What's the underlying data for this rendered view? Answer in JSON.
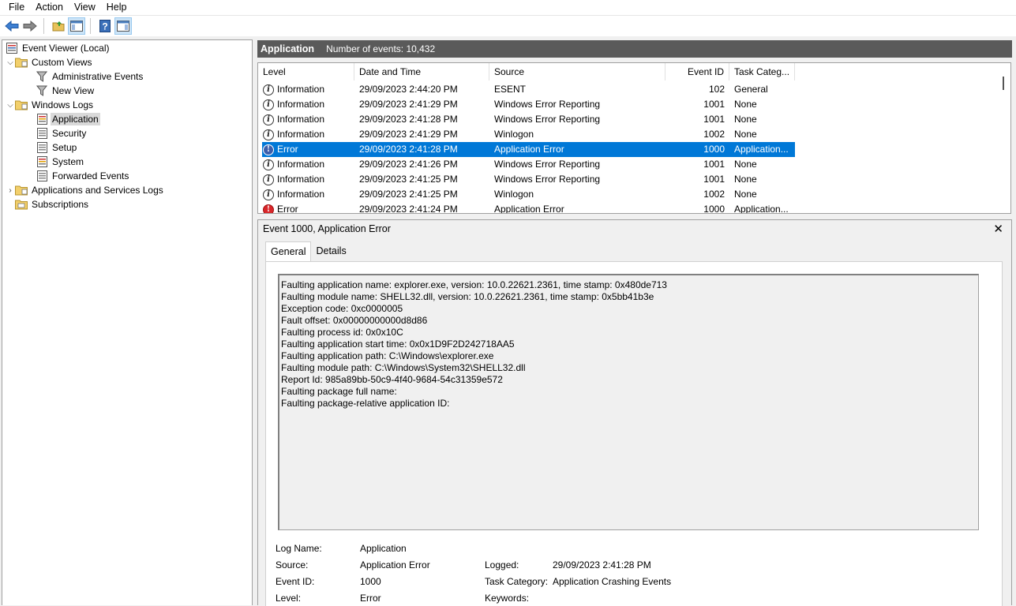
{
  "menu": [
    "File",
    "Action",
    "View",
    "Help"
  ],
  "toolbar": {
    "icons": [
      "back-arrow-icon",
      "forward-arrow-icon",
      "open-folder-icon",
      "show-hide-tree-icon",
      "help-icon",
      "action-pane-icon"
    ]
  },
  "tree": {
    "root": "Event Viewer (Local)",
    "custom_views": "Custom Views",
    "administrative_events": "Administrative Events",
    "new_view": "New View",
    "windows_logs": "Windows Logs",
    "application": "Application",
    "security": "Security",
    "setup": "Setup",
    "system": "System",
    "forwarded_events": "Forwarded Events",
    "app_services_logs": "Applications and Services Logs",
    "subscriptions": "Subscriptions"
  },
  "list_header": {
    "log_name": "Application",
    "count_text": "Number of events: 10,432"
  },
  "columns": {
    "level": "Level",
    "date": "Date and Time",
    "source": "Source",
    "event_id": "Event ID",
    "task": "Task Categ..."
  },
  "events": [
    {
      "level": "Information",
      "type": "info",
      "date": "29/09/2023 2:44:20 PM",
      "source": "ESENT",
      "id": "102",
      "task": "General"
    },
    {
      "level": "Information",
      "type": "info",
      "date": "29/09/2023 2:41:29 PM",
      "source": "Windows Error Reporting",
      "id": "1001",
      "task": "None"
    },
    {
      "level": "Information",
      "type": "info",
      "date": "29/09/2023 2:41:28 PM",
      "source": "Windows Error Reporting",
      "id": "1001",
      "task": "None"
    },
    {
      "level": "Information",
      "type": "info",
      "date": "29/09/2023 2:41:29 PM",
      "source": "Winlogon",
      "id": "1002",
      "task": "None"
    },
    {
      "level": "Error",
      "type": "err",
      "date": "29/09/2023 2:41:28 PM",
      "source": "Application Error",
      "id": "1000",
      "task": "Application...",
      "selected": true
    },
    {
      "level": "Information",
      "type": "info",
      "date": "29/09/2023 2:41:26 PM",
      "source": "Windows Error Reporting",
      "id": "1001",
      "task": "None"
    },
    {
      "level": "Information",
      "type": "info",
      "date": "29/09/2023 2:41:25 PM",
      "source": "Windows Error Reporting",
      "id": "1001",
      "task": "None"
    },
    {
      "level": "Information",
      "type": "info",
      "date": "29/09/2023 2:41:25 PM",
      "source": "Winlogon",
      "id": "1002",
      "task": "None"
    },
    {
      "level": "Error",
      "type": "err",
      "date": "29/09/2023 2:41:24 PM",
      "source": "Application Error",
      "id": "1000",
      "task": "Application..."
    }
  ],
  "detail": {
    "title": "Event 1000, Application Error",
    "close_glyph": "✕",
    "tabs": [
      "General",
      "Details"
    ],
    "description": [
      "Faulting application name: explorer.exe, version: 10.0.22621.2361, time stamp: 0x480de713",
      "Faulting module name: SHELL32.dll, version: 10.0.22621.2361, time stamp: 0x5bb41b3e",
      "Exception code: 0xc0000005",
      "Fault offset: 0x00000000000d8d86",
      "Faulting process id: 0x0x10C",
      "Faulting application start time: 0x0x1D9F2D242718AA5",
      "Faulting application path: C:\\Windows\\explorer.exe",
      "Faulting module path: C:\\Windows\\System32\\SHELL32.dll",
      "Report Id: 985a89bb-50c9-4f40-9684-54c31359e572",
      "Faulting package full name:",
      "Faulting package-relative application ID:"
    ],
    "props": {
      "log_name_label": "Log Name:",
      "log_name": "Application",
      "source_label": "Source:",
      "source": "Application Error",
      "logged_label": "Logged:",
      "logged": "29/09/2023 2:41:28 PM",
      "event_id_label": "Event ID:",
      "event_id": "1000",
      "task_label": "Task Category:",
      "task": "Application Crashing Events",
      "level_label": "Level:",
      "level": "Error",
      "keywords_label": "Keywords:"
    }
  }
}
